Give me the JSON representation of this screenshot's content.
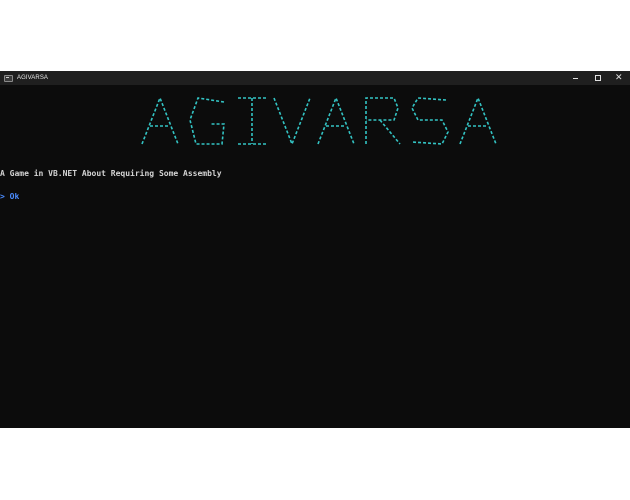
{
  "window": {
    "title": "AGIVARSA",
    "icon": "console-app-icon",
    "controls": {
      "minimize_icon": "minimize-icon",
      "maximize_icon": "maximize-icon",
      "close_icon": "close-icon"
    }
  },
  "console": {
    "banner_text": "AGIVARSA",
    "subtitle": "A Game in VB.NET About Requiring Some Assembly",
    "prompt_symbol": ">",
    "prompt_input": "Ok"
  },
  "colors": {
    "console_background": "#0c0c0c",
    "titlebar_background": "#1f1f1f",
    "banner_cyan": "#33c4c4",
    "subtitle_text": "#d4d4d4",
    "prompt_blue": "#4a8cff"
  }
}
